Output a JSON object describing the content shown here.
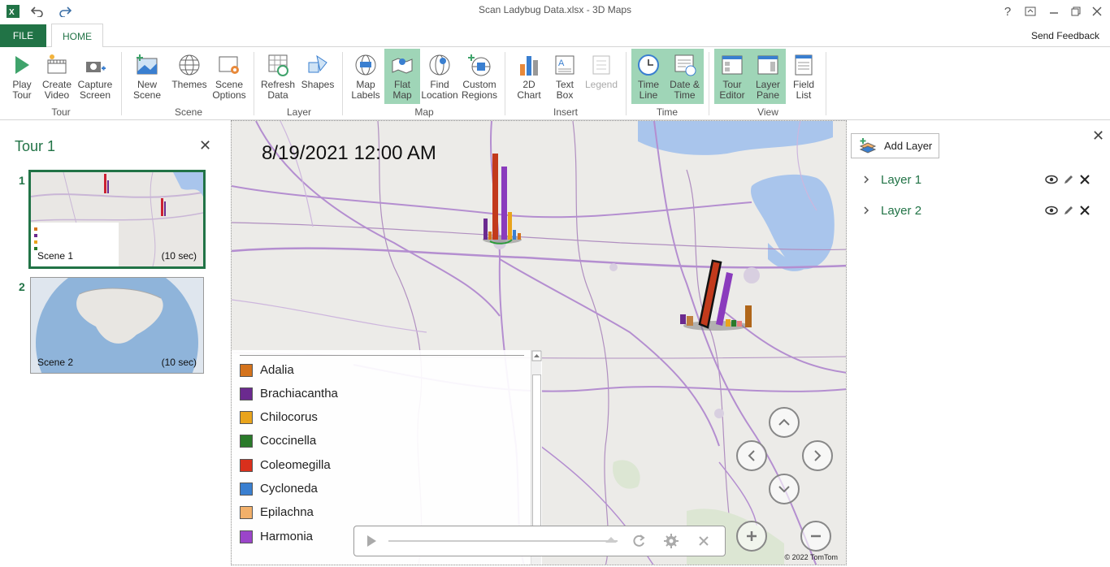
{
  "window": {
    "title": "Scan Ladybug Data.xlsx - 3D Maps"
  },
  "tabs": {
    "file": "FILE",
    "home": "HOME",
    "send_feedback": "Send Feedback"
  },
  "ribbon": {
    "tour": {
      "group": "Tour",
      "play": "Play\nTour",
      "create_video": "Create\nVideo",
      "capture": "Capture\nScreen"
    },
    "scene": {
      "group": "Scene",
      "new_scene": "New\nScene",
      "themes": "Themes",
      "options": "Scene\nOptions"
    },
    "layer": {
      "group": "Layer",
      "refresh": "Refresh\nData",
      "shapes": "Shapes"
    },
    "map": {
      "group": "Map",
      "labels": "Map\nLabels",
      "flat": "Flat\nMap",
      "find": "Find\nLocation",
      "custom": "Custom\nRegions"
    },
    "insert": {
      "group": "Insert",
      "chart": "2D\nChart",
      "text": "Text\nBox",
      "legend": "Legend"
    },
    "time": {
      "group": "Time",
      "timeline": "Time\nLine",
      "datetime": "Date &\nTime"
    },
    "view": {
      "group": "View",
      "tour_editor": "Tour\nEditor",
      "layer_pane": "Layer\nPane",
      "field_list": "Field\nList"
    }
  },
  "tour": {
    "title": "Tour 1",
    "scenes": [
      {
        "num": "1",
        "name": "Scene 1",
        "duration": "(10 sec)"
      },
      {
        "num": "2",
        "name": "Scene 2",
        "duration": "(10 sec)"
      }
    ]
  },
  "map": {
    "timestamp": "8/19/2021 12:00 AM",
    "copyright": "© 2022 TomTom",
    "legend": [
      {
        "label": "Adalia",
        "color": "#d4731c"
      },
      {
        "label": "Brachiacantha",
        "color": "#6b2a8f"
      },
      {
        "label": "Chilocorus",
        "color": "#e9a41c"
      },
      {
        "label": "Coccinella",
        "color": "#2a7a2a"
      },
      {
        "label": "Coleomegilla",
        "color": "#d9301c"
      },
      {
        "label": "Cycloneda",
        "color": "#3a7fd0"
      },
      {
        "label": "Epilachna",
        "color": "#f2b06a"
      },
      {
        "label": "Harmonia",
        "color": "#9b45c9"
      }
    ]
  },
  "layers": {
    "add_label": "Add Layer",
    "items": [
      {
        "name": "Layer 1"
      },
      {
        "name": "Layer 2"
      }
    ]
  }
}
